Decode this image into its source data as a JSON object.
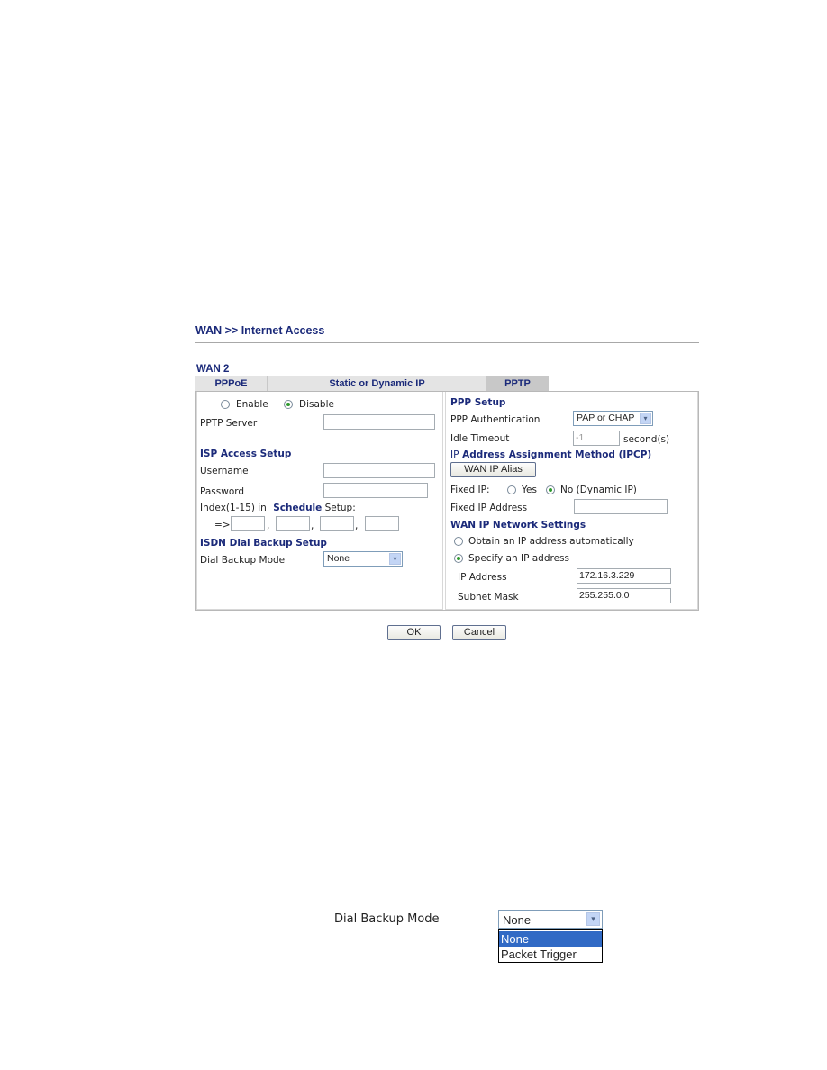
{
  "header": {
    "title": "WAN >> Internet Access",
    "section": "WAN 2"
  },
  "tabs": [
    {
      "label": "PPPoE",
      "active": false
    },
    {
      "label": "Static or Dynamic IP",
      "active": false
    },
    {
      "label": "PPTP",
      "active": true
    }
  ],
  "left": {
    "enable_label": "Enable",
    "disable_label": "Disable",
    "enabled": false,
    "pptp_server_label": "PPTP Server",
    "pptp_server_value": "",
    "isp_section": "ISP Access Setup",
    "username_label": "Username",
    "username_value": "",
    "password_label": "Password",
    "password_value": "",
    "index_prefix": "Index(1-15) in",
    "schedule_link": "Schedule",
    "index_suffix": "Setup:",
    "arrow_label": "=>",
    "schedule_values": [
      "",
      "",
      "",
      ""
    ],
    "comma": ",",
    "isdn_section_prefix": "ISDN",
    "isdn_section_rest": "Dial Backup Setup",
    "dial_backup_label": "Dial Backup Mode",
    "dial_backup_value": "None"
  },
  "right": {
    "ppp_section": "PPP Setup",
    "ppp_auth_label": "PPP Authentication",
    "ppp_auth_value": "PAP or CHAP",
    "idle_timeout_label": "Idle Timeout",
    "idle_timeout_value": "-1",
    "idle_timeout_unit": "second(s)",
    "ipcp_section_prefix": "IP",
    "ipcp_section_rest": "Address Assignment Method (IPCP)",
    "wan_ip_alias_button": "WAN IP Alias",
    "fixed_ip_label": "Fixed IP:",
    "fixed_yes": "Yes",
    "fixed_no": "No (Dynamic IP)",
    "fixed_ip_selected": "No",
    "fixed_ip_address_label": "Fixed IP Address",
    "fixed_ip_address_value": "",
    "wan_net_section": "WAN IP Network Settings",
    "obtain_auto_label": "Obtain an IP address automatically",
    "specify_label": "Specify an IP address",
    "ip_mode_selected": "specify",
    "ip_address_label": "IP Address",
    "ip_address_value": "172.16.3.229",
    "subnet_mask_label": "Subnet Mask",
    "subnet_mask_value": "255.255.0.0"
  },
  "buttons": {
    "ok": "OK",
    "cancel": "Cancel"
  },
  "dropdown_detail": {
    "label": "Dial Backup Mode",
    "value": "None",
    "options": [
      "None",
      "Packet Trigger"
    ],
    "highlighted": "None"
  },
  "icons": {
    "select_arrow": "▾",
    "radio": "radio"
  }
}
